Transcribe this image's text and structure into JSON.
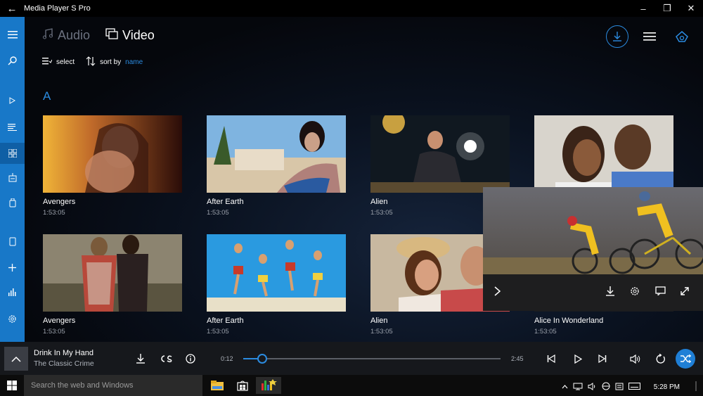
{
  "window": {
    "title": "Media Player S Pro"
  },
  "tabs": [
    {
      "label": "Audio",
      "active": false
    },
    {
      "label": "Video",
      "active": true
    }
  ],
  "toolbar": {
    "select_label": "select",
    "sort_prefix": "sort by",
    "sort_value": "name"
  },
  "section": {
    "letter": "A"
  },
  "videos": [
    {
      "title": "Avengers",
      "duration": "1:53:05"
    },
    {
      "title": "After Earth",
      "duration": "1:53:05"
    },
    {
      "title": "Alien",
      "duration": "1:53:05"
    },
    {
      "title": "",
      "duration": ""
    },
    {
      "title": "Avengers",
      "duration": "1:53:05"
    },
    {
      "title": "After Earth",
      "duration": "1:53:05"
    },
    {
      "title": "Alien",
      "duration": "1:53:05"
    },
    {
      "title": "Alice In Wonderland",
      "duration": "1:53:05"
    }
  ],
  "now_playing": {
    "title": "Drink In My Hand",
    "artist": "The Classic Crime",
    "elapsed": "0:12",
    "total": "2:45",
    "progress": 0.073
  },
  "taskbar": {
    "search_placeholder": "Search the web and Windows",
    "clock": "5:28 PM"
  },
  "colors": {
    "accent": "#2b8be0",
    "sidebar": "#1878c8"
  }
}
